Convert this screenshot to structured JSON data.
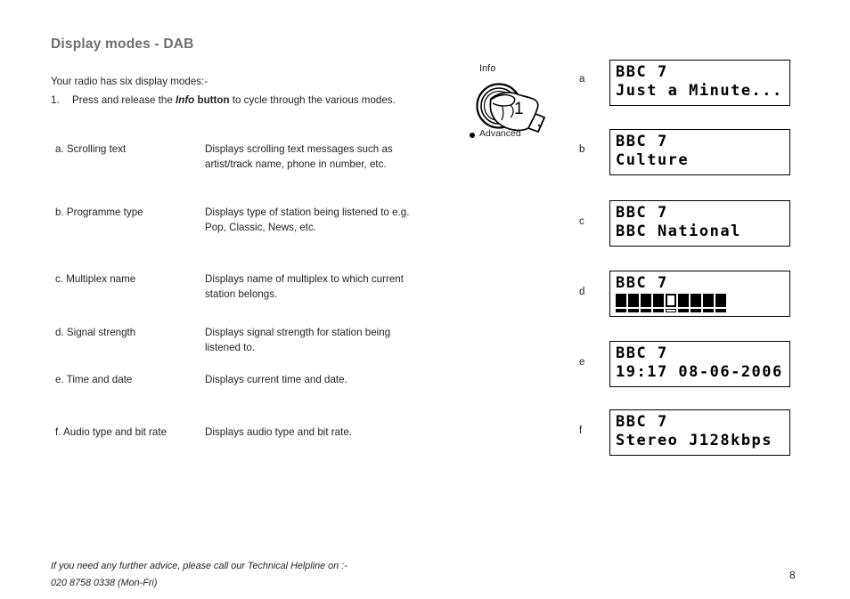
{
  "page": {
    "title": "Display modes - DAB",
    "number": "8"
  },
  "intro": {
    "lead": "Your radio has six display modes:-",
    "step_number": "1.",
    "step_text_before": "Press and release the ",
    "step_emphasis_italic": "Info",
    "step_emphasis_bold": "button",
    "step_text_after": " to cycle through the various modes."
  },
  "modes": [
    {
      "letter": "a.",
      "label": "a. Scrolling text",
      "description": "Displays scrolling text messages such as artist/track name, phone in number, etc."
    },
    {
      "letter": "b.",
      "label": "b. Programme type",
      "description": "Displays type of station being listened to e.g. Pop, Classic, News, etc."
    },
    {
      "letter": "c.",
      "label": "c. Multiplex name",
      "description": "Displays name of multiplex to which current  station belongs."
    },
    {
      "letter": "d.",
      "label": "d. Signal strength",
      "description": "Displays signal strength for station being listened to."
    },
    {
      "letter": "e.",
      "label": "e. Time and date",
      "description": "Displays current time and date."
    },
    {
      "letter": "f.",
      "label": "f. Audio type and bit rate",
      "description": "Displays audio type and bit rate."
    }
  ],
  "knob": {
    "info_label": "Info",
    "advanced_label": "Advanced",
    "step_marker": "1"
  },
  "displays": [
    {
      "key": "a",
      "letter": "a",
      "line1": "BBC 7",
      "line2": "Just a Minute...",
      "type": "text"
    },
    {
      "key": "b",
      "letter": "b",
      "line1": "BBC 7",
      "line2": "Culture",
      "type": "text"
    },
    {
      "key": "c",
      "letter": "c",
      "line1": "BBC 7",
      "line2": "BBC National",
      "type": "text"
    },
    {
      "key": "d",
      "letter": "d",
      "line1": "BBC 7",
      "line2": "",
      "type": "signal",
      "signal_blocks": [
        1,
        1,
        1,
        1,
        0,
        1,
        1,
        1,
        1
      ]
    },
    {
      "key": "e",
      "letter": "e",
      "line1": "BBC 7",
      "line2": "19:17 08-06-2006",
      "type": "text"
    },
    {
      "key": "f",
      "letter": "f",
      "line1": "BBC 7",
      "line2": "Stereo J128kbps",
      "type": "text"
    }
  ],
  "footer": {
    "line1": "If you need any further advice, please call our Technical Helpline on :-",
    "line2": "020 8758 0338 (Mon-Fri)"
  },
  "colors": {
    "heading": "#6d6e71",
    "body_text": "#231f20",
    "lcd_border": "#000000",
    "lcd_background": "#ffffff"
  }
}
